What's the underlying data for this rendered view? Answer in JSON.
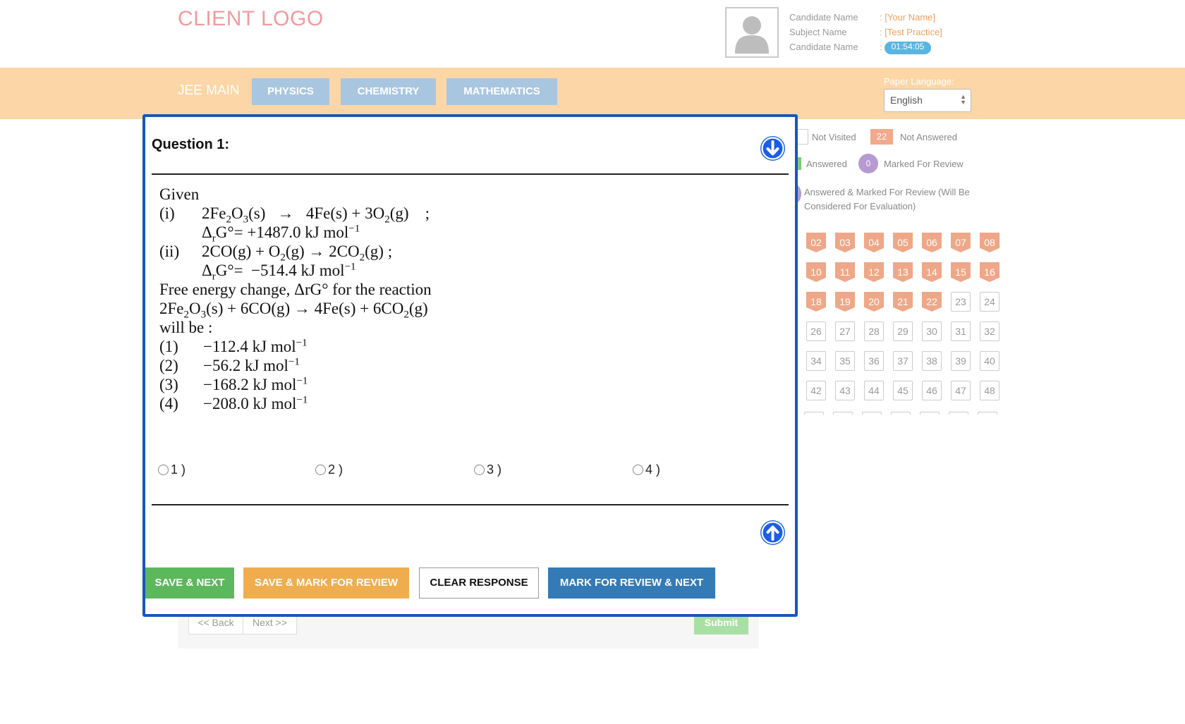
{
  "header": {
    "logo": "CLIENT LOGO",
    "candidate": [
      {
        "key": "Candidate Name",
        "value": ": [Your Name]"
      },
      {
        "key": "Subject Name",
        "value": ": [Test Practice]"
      },
      {
        "key": "Candidate Name",
        "value": ":",
        "timer": "01:54:05"
      }
    ]
  },
  "topbar": {
    "exam_name": "JEE MAIN",
    "tabs": [
      "PHYSICS",
      "CHEMISTRY",
      "MATHEMATICS"
    ],
    "language_label": "Paper Language:",
    "language_value": "English"
  },
  "legend": {
    "not_visited": "Not Visited",
    "not_answered_count": "22",
    "not_answered": "Not Answered",
    "answered": "Answered",
    "marked_count": "0",
    "marked": "Marked For Review",
    "answered_marked_line1": "Answered & Marked For Review (Will Be",
    "answered_marked_line2": "Considered For Evaluation)"
  },
  "palette": {
    "rows": [
      {
        "nums": [
          "02",
          "03",
          "04",
          "05",
          "06",
          "07",
          "08"
        ],
        "states": [
          "na",
          "na",
          "na",
          "na",
          "na",
          "na",
          "na"
        ]
      },
      {
        "nums": [
          "10",
          "11",
          "12",
          "13",
          "14",
          "15",
          "16"
        ],
        "states": [
          "na",
          "na",
          "na",
          "na",
          "na",
          "na",
          "na"
        ]
      },
      {
        "nums": [
          "18",
          "19",
          "20",
          "21",
          "22",
          "23",
          "24"
        ],
        "states": [
          "na",
          "na",
          "na",
          "na",
          "na",
          "nv",
          "nv"
        ]
      },
      {
        "nums": [
          "26",
          "27",
          "28",
          "29",
          "30",
          "31",
          "32"
        ],
        "states": [
          "nv",
          "nv",
          "nv",
          "nv",
          "nv",
          "nv",
          "nv"
        ]
      },
      {
        "nums": [
          "34",
          "35",
          "36",
          "37",
          "38",
          "39",
          "40"
        ],
        "states": [
          "nv",
          "nv",
          "nv",
          "nv",
          "nv",
          "nv",
          "nv"
        ]
      },
      {
        "nums": [
          "42",
          "43",
          "44",
          "45",
          "46",
          "47",
          "48"
        ],
        "states": [
          "nv",
          "nv",
          "nv",
          "nv",
          "nv",
          "nv",
          "nv"
        ]
      }
    ]
  },
  "nav": {
    "back": "<< Back",
    "next": "Next >>",
    "submit": "Submit"
  },
  "question": {
    "title": "Question 1:",
    "given": "Given",
    "i_label": "(i)",
    "ii_label": "(ii)",
    "free_energy_line": "Free energy change, ΔrG° for the reaction",
    "will_be": "will be :",
    "choices": [
      {
        "label": "(1)",
        "text": "−112.4 kJ mol"
      },
      {
        "label": "(2)",
        "text": "−56.2 kJ mol"
      },
      {
        "label": "(3)",
        "text": "−168.2 kJ mol"
      },
      {
        "label": "(4)",
        "text": "−208.0 kJ mol"
      }
    ],
    "options": [
      "1 )",
      "2 )",
      "3 )",
      "4 )"
    ]
  },
  "actions": {
    "save_next": "SAVE & NEXT",
    "save_mark": "SAVE & MARK FOR REVIEW",
    "clear": "CLEAR RESPONSE",
    "mark_next": "MARK FOR REVIEW & NEXT"
  },
  "colors": {
    "panel_border": "#1a56b8",
    "topbar": "#fcd6a6",
    "tab": "#a9c6e0",
    "save_next": "#5cb85c",
    "save_mark": "#f0ad4e",
    "mark_next": "#337ab7",
    "not_answered": "#eea788"
  }
}
